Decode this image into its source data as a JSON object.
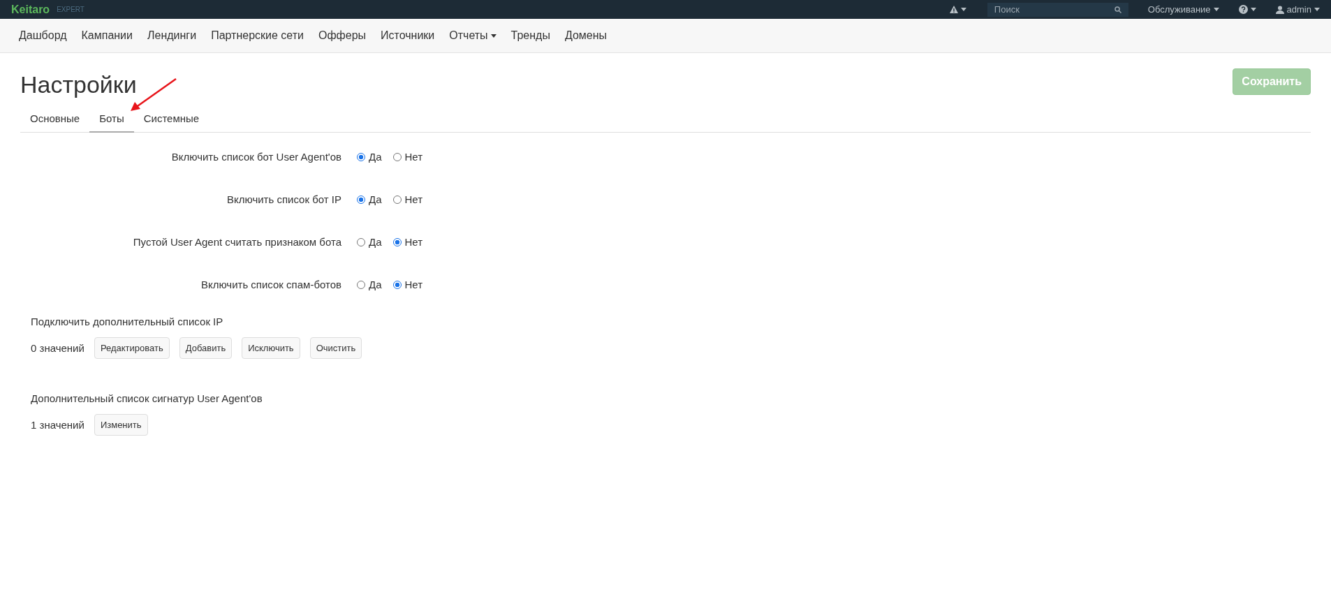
{
  "topbar": {
    "logo": "Keitaro",
    "edition": "EXPERT",
    "search": {
      "placeholder": "Поиск"
    },
    "menu": "Обслуживание",
    "user": "admin"
  },
  "nav": [
    {
      "label": "Дашборд",
      "dropdown": false
    },
    {
      "label": "Кампании",
      "dropdown": false
    },
    {
      "label": "Лендинги",
      "dropdown": false
    },
    {
      "label": "Партнерские сети",
      "dropdown": false
    },
    {
      "label": "Офферы",
      "dropdown": false
    },
    {
      "label": "Источники",
      "dropdown": false
    },
    {
      "label": "Отчеты",
      "dropdown": true
    },
    {
      "label": "Тренды",
      "dropdown": false
    },
    {
      "label": "Домены",
      "dropdown": false
    }
  ],
  "page": {
    "title": "Настройки",
    "save": {
      "label": "Сохранить",
      "disabled": true
    }
  },
  "tabs": [
    {
      "label": "Основные",
      "selected": false
    },
    {
      "label": "Боты",
      "selected": true
    },
    {
      "label": "Системные",
      "selected": false
    }
  ],
  "settings": [
    {
      "label": "Включить список бот User Agent'ов",
      "options": [
        {
          "label": "Да",
          "selected": true
        },
        {
          "label": "Нет",
          "selected": false
        }
      ]
    },
    {
      "label": "Включить список бот IP",
      "options": [
        {
          "label": "Да",
          "selected": true
        },
        {
          "label": "Нет",
          "selected": false
        }
      ]
    },
    {
      "label": "Пустой User Agent считать признаком бота",
      "options": [
        {
          "label": "Да",
          "selected": false
        },
        {
          "label": "Нет",
          "selected": true
        }
      ]
    },
    {
      "label": "Включить список спам-ботов",
      "options": [
        {
          "label": "Да",
          "selected": false
        },
        {
          "label": "Нет",
          "selected": true
        }
      ]
    }
  ],
  "lists": [
    {
      "title": "Подключить дополнительный список IP",
      "count": "0 значений",
      "buttons": [
        "Редактировать",
        "Добавить",
        "Исключить",
        "Очистить"
      ]
    },
    {
      "title": "Дополнительный список сигнатур User Agent'ов",
      "count": "1 значений",
      "buttons": [
        "Изменить"
      ]
    }
  ]
}
